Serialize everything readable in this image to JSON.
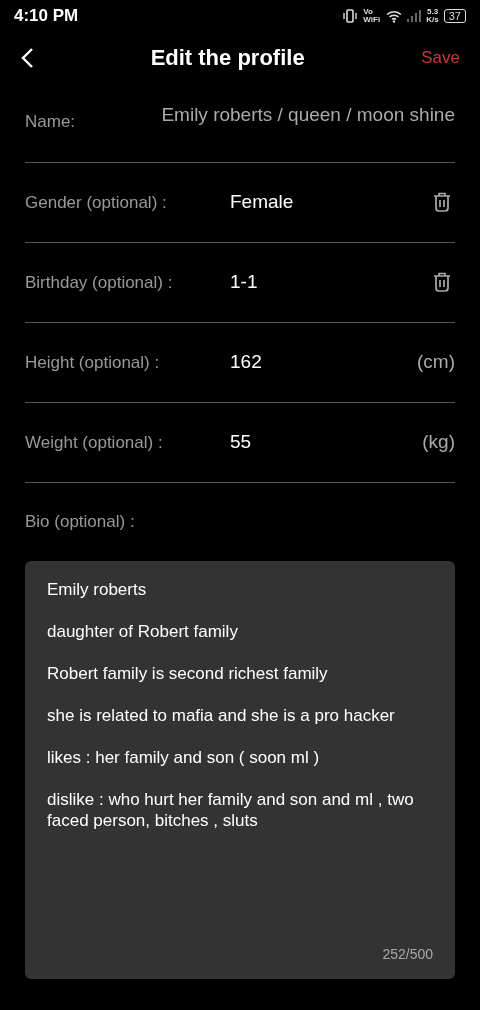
{
  "status_bar": {
    "time": "4:10 PM",
    "network_label": "Vo WiFi",
    "speed_value": "5.3",
    "speed_unit": "K/s",
    "battery": "37"
  },
  "header": {
    "title": "Edit the profile",
    "action": "Save"
  },
  "fields": [
    {
      "kind": "text",
      "label": "Name:",
      "value": "Emily roberts / queen / moon shine"
    },
    {
      "kind": "clearable",
      "label": "Gender (optional) :",
      "value": "Female"
    },
    {
      "kind": "clearable",
      "label": "Birthday (optional) :",
      "value": "1-1"
    },
    {
      "kind": "measure",
      "label": "Height (optional) :",
      "value": "162",
      "unit": "(cm)"
    },
    {
      "kind": "measure",
      "label": "Weight (optional) :",
      "value": "55",
      "unit": "(kg)"
    }
  ],
  "bio": {
    "label": "Bio (optional) :",
    "lines": [
      "Emily roberts",
      "daughter of Robert family",
      "Robert family is second richest family",
      "she is related to mafia and she is a pro hacker",
      "likes : her family and son ( soon ml )",
      "dislike : who hurt her family and son and ml , two faced person, bitches , sluts"
    ],
    "counter": "252/500"
  }
}
